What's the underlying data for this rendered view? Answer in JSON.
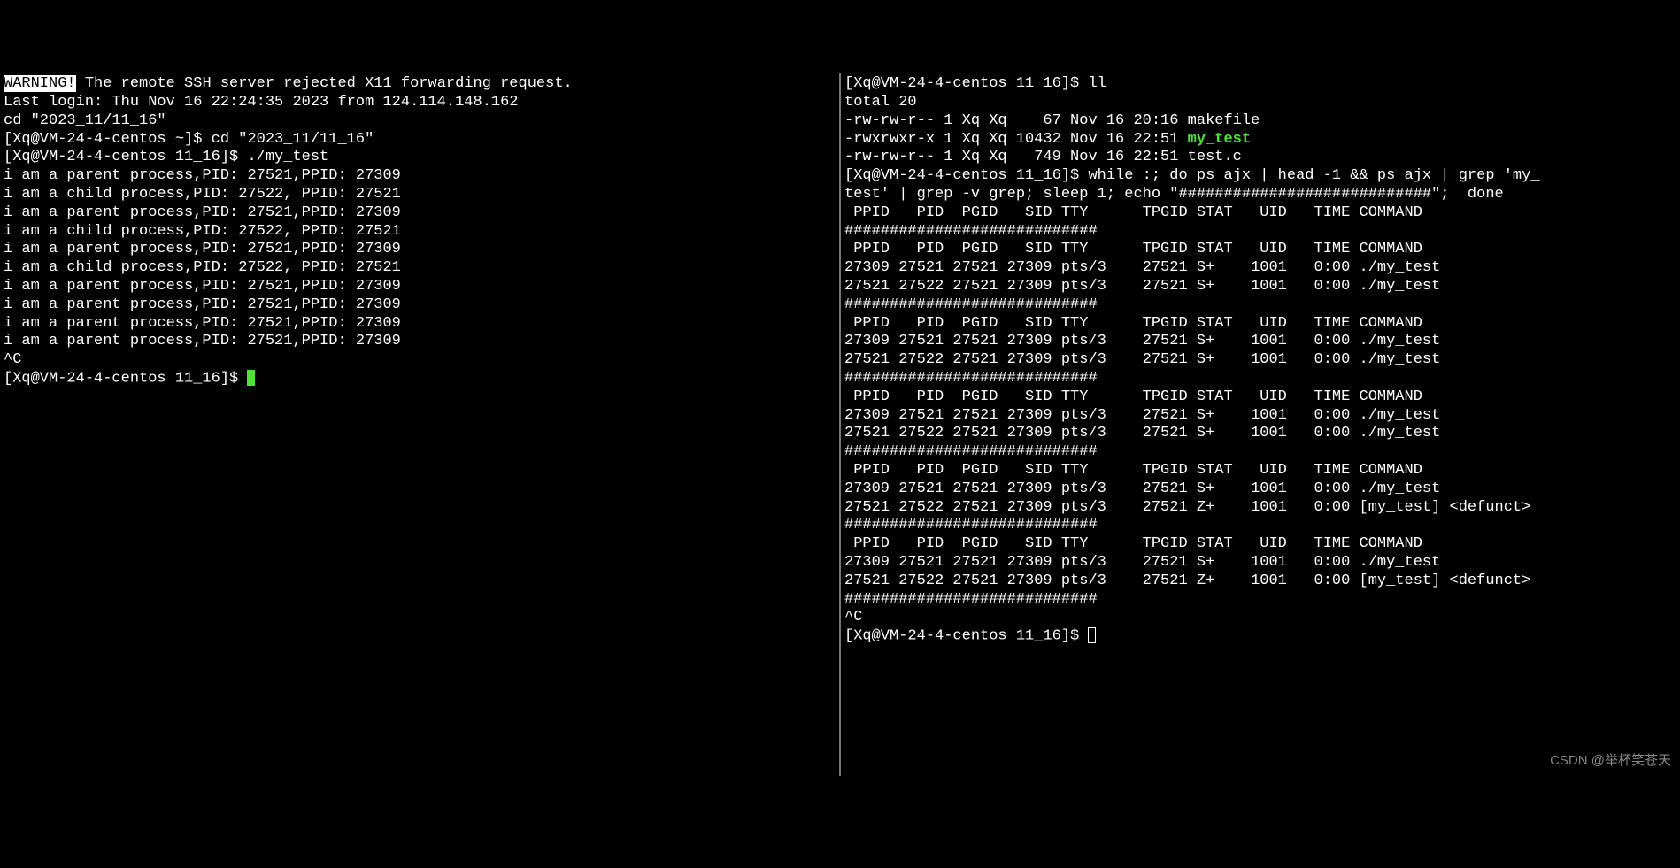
{
  "watermark": "CSDN @举杯笑苍天",
  "left": {
    "warning_label": "WARNING!",
    "warning_text": " The remote SSH server rejected X11 forwarding request.",
    "last_login": "Last login: Thu Nov 16 22:24:35 2023 from 124.114.148.162",
    "cd_line": "cd \"2023_11/11_16\"",
    "prompt1": "[Xq@VM-24-4-centos ~]$ cd \"2023_11/11_16\"",
    "prompt2": "[Xq@VM-24-4-centos 11_16]$ ./my_test",
    "out": [
      "i am a parent process,PID: 27521,PPID: 27309",
      "i am a child process,PID: 27522, PPID: 27521",
      "i am a parent process,PID: 27521,PPID: 27309",
      "i am a child process,PID: 27522, PPID: 27521",
      "i am a parent process,PID: 27521,PPID: 27309",
      "i am a child process,PID: 27522, PPID: 27521",
      "i am a parent process,PID: 27521,PPID: 27309",
      "i am a parent process,PID: 27521,PPID: 27309",
      "i am a parent process,PID: 27521,PPID: 27309",
      "i am a parent process,PID: 27521,PPID: 27309"
    ],
    "ctrl_c": "^C",
    "prompt3": "[Xq@VM-24-4-centos 11_16]$ "
  },
  "right": {
    "prompt_ll": "[Xq@VM-24-4-centos 11_16]$ ll",
    "total": "total 20",
    "ls": [
      {
        "perm": "-rw-rw-r--",
        "n": "1",
        "u": "Xq",
        "g": "Xq",
        "size": "   67",
        "date": "Nov 16 20:16",
        "name": "makefile",
        "exe": false
      },
      {
        "perm": "-rwxrwxr-x",
        "n": "1",
        "u": "Xq",
        "g": "Xq",
        "size": "10432",
        "date": "Nov 16 22:51",
        "name": "my_test",
        "exe": true
      },
      {
        "perm": "-rw-rw-r--",
        "n": "1",
        "u": "Xq",
        "g": "Xq",
        "size": "  749",
        "date": "Nov 16 22:51",
        "name": "test.c",
        "exe": false
      }
    ],
    "prompt_while_1": "[Xq@VM-24-4-centos 11_16]$ while :; do ps ajx | head -1 && ps ajx | grep 'my_",
    "prompt_while_2": "test' | grep -v grep; sleep 1; echo \"############################\";  done",
    "header": " PPID   PID  PGID   SID TTY      TPGID STAT   UID   TIME COMMAND",
    "sep": "############################",
    "blocks": [
      [
        {
          "ppid": "27309",
          "pid": "27521",
          "pgid": "27521",
          "sid": "27309",
          "tty": "pts/3",
          "tpgid": "27521",
          "stat": "S+",
          "uid": "1001",
          "time": "0:00",
          "cmd": "./my_test"
        },
        {
          "ppid": "27521",
          "pid": "27522",
          "pgid": "27521",
          "sid": "27309",
          "tty": "pts/3",
          "tpgid": "27521",
          "stat": "S+",
          "uid": "1001",
          "time": "0:00",
          "cmd": "./my_test"
        }
      ],
      [
        {
          "ppid": "27309",
          "pid": "27521",
          "pgid": "27521",
          "sid": "27309",
          "tty": "pts/3",
          "tpgid": "27521",
          "stat": "S+",
          "uid": "1001",
          "time": "0:00",
          "cmd": "./my_test"
        },
        {
          "ppid": "27521",
          "pid": "27522",
          "pgid": "27521",
          "sid": "27309",
          "tty": "pts/3",
          "tpgid": "27521",
          "stat": "S+",
          "uid": "1001",
          "time": "0:00",
          "cmd": "./my_test"
        }
      ],
      [
        {
          "ppid": "27309",
          "pid": "27521",
          "pgid": "27521",
          "sid": "27309",
          "tty": "pts/3",
          "tpgid": "27521",
          "stat": "S+",
          "uid": "1001",
          "time": "0:00",
          "cmd": "./my_test"
        },
        {
          "ppid": "27521",
          "pid": "27522",
          "pgid": "27521",
          "sid": "27309",
          "tty": "pts/3",
          "tpgid": "27521",
          "stat": "S+",
          "uid": "1001",
          "time": "0:00",
          "cmd": "./my_test"
        }
      ],
      [
        {
          "ppid": "27309",
          "pid": "27521",
          "pgid": "27521",
          "sid": "27309",
          "tty": "pts/3",
          "tpgid": "27521",
          "stat": "S+",
          "uid": "1001",
          "time": "0:00",
          "cmd": "./my_test"
        },
        {
          "ppid": "27521",
          "pid": "27522",
          "pgid": "27521",
          "sid": "27309",
          "tty": "pts/3",
          "tpgid": "27521",
          "stat": "Z+",
          "uid": "1001",
          "time": "0:00",
          "cmd": "[my_test] <defunct>"
        }
      ],
      [
        {
          "ppid": "27309",
          "pid": "27521",
          "pgid": "27521",
          "sid": "27309",
          "tty": "pts/3",
          "tpgid": "27521",
          "stat": "S+",
          "uid": "1001",
          "time": "0:00",
          "cmd": "./my_test"
        },
        {
          "ppid": "27521",
          "pid": "27522",
          "pgid": "27521",
          "sid": "27309",
          "tty": "pts/3",
          "tpgid": "27521",
          "stat": "Z+",
          "uid": "1001",
          "time": "0:00",
          "cmd": "[my_test] <defunct>"
        }
      ]
    ],
    "ctrl_c": "^C",
    "prompt_end": "[Xq@VM-24-4-centos 11_16]$ "
  }
}
